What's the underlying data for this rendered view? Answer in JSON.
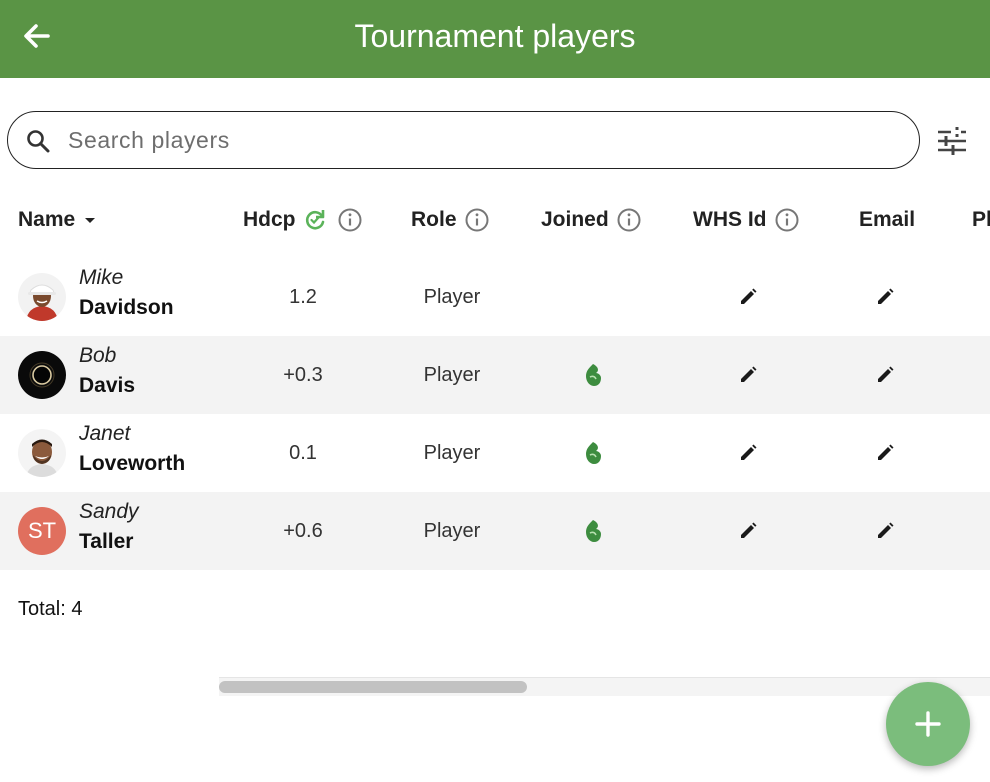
{
  "app_bar": {
    "title": "Tournament players",
    "background": "#5a9445"
  },
  "search": {
    "placeholder": "Search players",
    "value": ""
  },
  "table": {
    "columns": {
      "name": "Name",
      "hdcp": "Hdcp",
      "role": "Role",
      "joined": "Joined",
      "whs_id": "WHS Id",
      "email": "Email",
      "phone_partial": "Ph"
    },
    "sort": {
      "column": "Name",
      "direction": "descending-arrow"
    },
    "rows": [
      {
        "first_name": "Mike",
        "last_name": "Davidson",
        "hdcp": "1.2",
        "role": "Player",
        "joined": false,
        "avatar": "photo-golfer-cap"
      },
      {
        "first_name": "Bob",
        "last_name": "Davis",
        "hdcp": "+0.3",
        "role": "Player",
        "joined": true,
        "avatar": "photo-eclipse"
      },
      {
        "first_name": "Janet",
        "last_name": "Loveworth",
        "hdcp": "0.1",
        "role": "Player",
        "joined": true,
        "avatar": "photo-smiling-man"
      },
      {
        "first_name": "Sandy",
        "last_name": "Taller",
        "hdcp": "+0.6",
        "role": "Player",
        "joined": true,
        "avatar_initials": "ST",
        "avatar_color": "#e06f5e"
      }
    ]
  },
  "footer": {
    "total_label": "Total: 4"
  },
  "colors": {
    "accent_green": "#5a9445",
    "fab_green": "#7bbd7c",
    "joined_icon_green": "#3d8c3f",
    "row_alt": "#f3f3f3"
  }
}
